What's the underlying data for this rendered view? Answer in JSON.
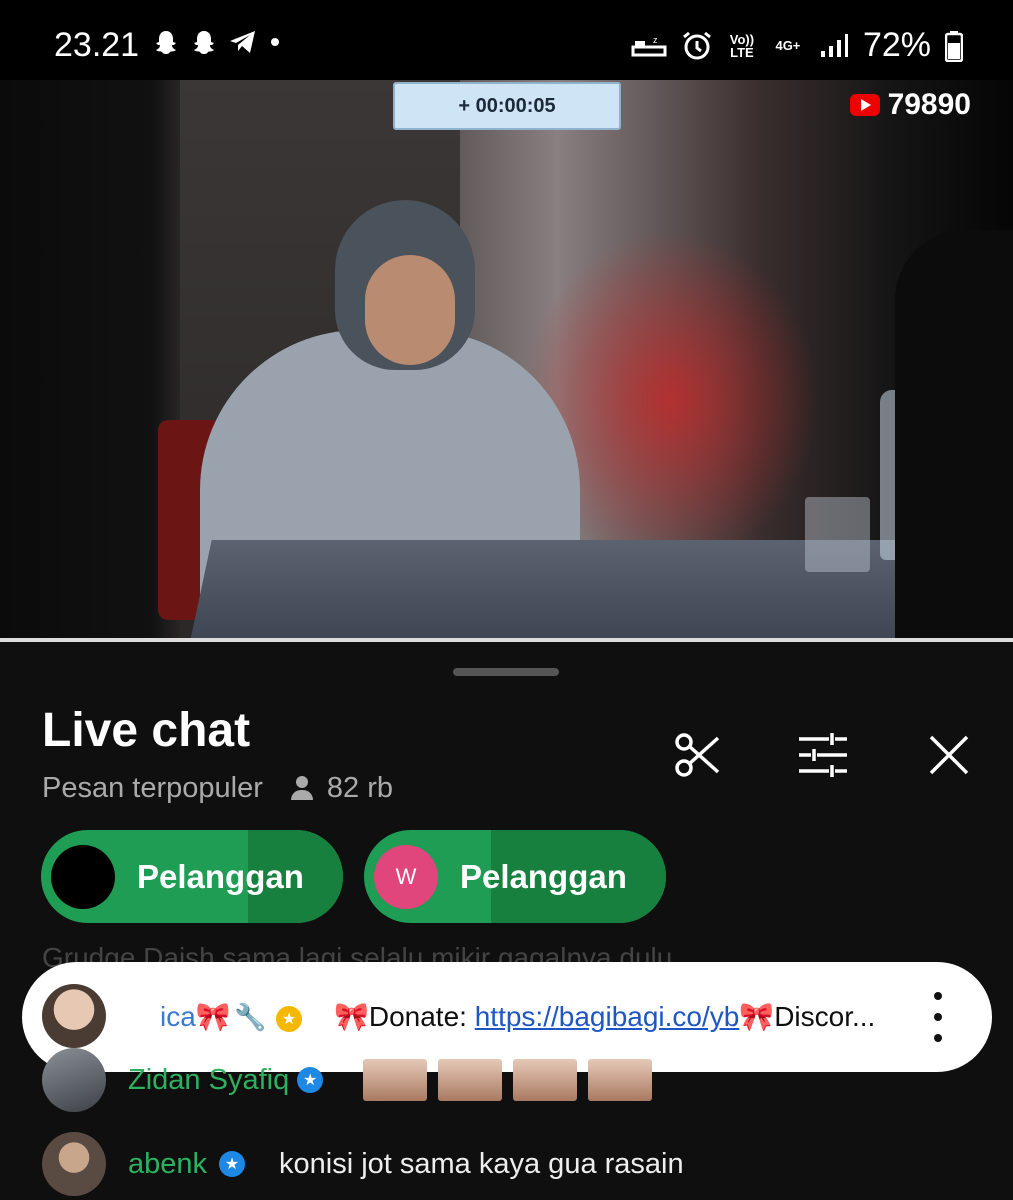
{
  "status_bar": {
    "time": "23.21",
    "left_icons": [
      "snapchat-icon",
      "snapchat-icon",
      "telegram-icon",
      "dot-icon"
    ],
    "volte_label": "Vo)) LTE",
    "network_label": "4G+",
    "battery": "72%"
  },
  "video": {
    "timer": "+ 00:00:05",
    "viewer_count": "79890"
  },
  "chat": {
    "title": "Live chat",
    "mode": "Pesan terpopuler",
    "viewers": "82 rb",
    "chips": [
      {
        "label": "Pelanggan",
        "avatar_letter": ""
      },
      {
        "label": "Pelanggan",
        "avatar_letter": "W"
      }
    ],
    "obscured_row": "Grudge Daish  sama lagi selalu mikir gagalnya dulu",
    "pinned": {
      "name": "ica🎀",
      "message_prefix": "🎀Donate: ",
      "link": "https://bagibagi.co/yb",
      "message_suffix": "🎀Discor..."
    },
    "messages": [
      {
        "name": "Zidan Syafiq",
        "text": ""
      },
      {
        "name": "abenk",
        "text": "konisi jot sama kaya gua rasain"
      }
    ]
  },
  "colors": {
    "chip_green": "#1f9d55",
    "name_green": "#2bb15f",
    "link_blue": "#1e56c4",
    "verified_blue": "#1e88e5",
    "badge_yellow": "#f5b800"
  }
}
